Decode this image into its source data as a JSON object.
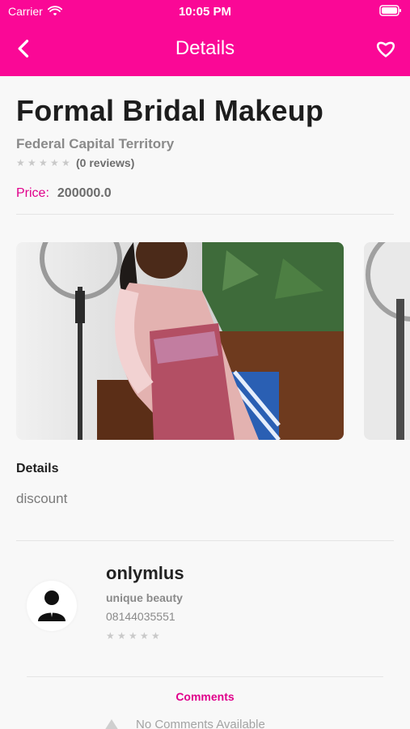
{
  "status_bar": {
    "carrier": "Carrier",
    "time": "10:05 PM"
  },
  "nav": {
    "title": "Details"
  },
  "listing": {
    "title": "Formal Bridal Makeup",
    "location": "Federal Capital Territory",
    "reviews_text": "(0 reviews)",
    "rating": 0,
    "price_label": "Price:",
    "price_value": "200000.0"
  },
  "details": {
    "heading": "Details",
    "text": "discount"
  },
  "seller": {
    "name": "onlymlus",
    "business": "unique beauty",
    "phone": "08144035551",
    "rating": 0
  },
  "comments": {
    "title": "Comments",
    "empty_text": "No Comments Available"
  },
  "colors": {
    "accent": "#fa0896",
    "accent_text": "#e0008b"
  },
  "icons": {
    "back": "chevron-left-icon",
    "favorite": "heart-icon",
    "wifi": "wifi-icon",
    "battery": "battery-icon",
    "star": "star-icon",
    "user": "user-icon"
  }
}
